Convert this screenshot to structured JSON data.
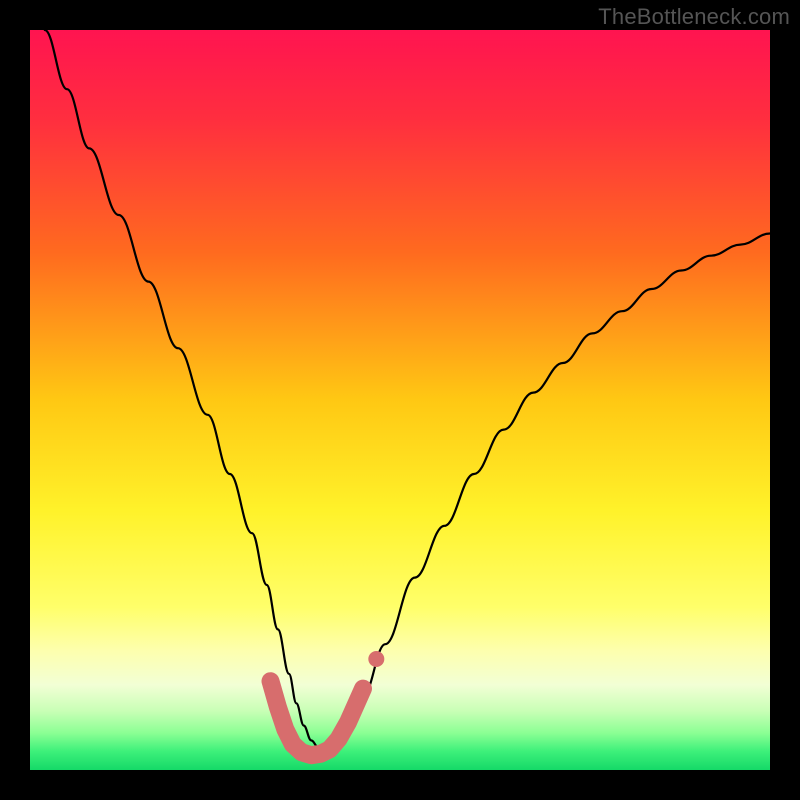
{
  "watermark": "TheBottleneck.com",
  "colors": {
    "frame": "#000000",
    "gradient_stops": [
      {
        "offset": 0.0,
        "color": "#ff1450"
      },
      {
        "offset": 0.12,
        "color": "#ff2e3f"
      },
      {
        "offset": 0.3,
        "color": "#ff6a1f"
      },
      {
        "offset": 0.5,
        "color": "#ffc813"
      },
      {
        "offset": 0.65,
        "color": "#fff22a"
      },
      {
        "offset": 0.78,
        "color": "#ffff6a"
      },
      {
        "offset": 0.84,
        "color": "#fdffaf"
      },
      {
        "offset": 0.885,
        "color": "#f2ffd5"
      },
      {
        "offset": 0.92,
        "color": "#c9ffb6"
      },
      {
        "offset": 0.95,
        "color": "#8bff94"
      },
      {
        "offset": 0.975,
        "color": "#3df07a"
      },
      {
        "offset": 1.0,
        "color": "#15d968"
      }
    ],
    "curve": "#000000",
    "marker_fill": "#d76d6d",
    "marker_stroke": "#c85f5f"
  },
  "chart_data": {
    "type": "line",
    "title": "",
    "xlabel": "",
    "ylabel": "",
    "xlim": [
      0,
      100
    ],
    "ylim": [
      0,
      100
    ],
    "series": [
      {
        "name": "bottleneck-curve",
        "x": [
          2,
          5,
          8,
          12,
          16,
          20,
          24,
          27,
          30,
          32,
          33.5,
          35,
          36,
          37,
          38,
          39,
          40,
          41.5,
          43,
          45,
          48,
          52,
          56,
          60,
          64,
          68,
          72,
          76,
          80,
          84,
          88,
          92,
          96,
          100
        ],
        "y": [
          100,
          92,
          84,
          75,
          66,
          57,
          48,
          40,
          32,
          25,
          19,
          13,
          9,
          6,
          4,
          3,
          3,
          4,
          6,
          10,
          17,
          26,
          33,
          40,
          46,
          51,
          55,
          59,
          62,
          65,
          67.5,
          69.5,
          71,
          72.5
        ]
      }
    ],
    "markers": {
      "name": "sweet-spot",
      "points": [
        {
          "x": 32.5,
          "y": 12.0
        },
        {
          "x": 33.5,
          "y": 8.5
        },
        {
          "x": 34.5,
          "y": 5.5
        },
        {
          "x": 35.5,
          "y": 3.5
        },
        {
          "x": 36.7,
          "y": 2.4
        },
        {
          "x": 38.0,
          "y": 2.0
        },
        {
          "x": 39.3,
          "y": 2.2
        },
        {
          "x": 40.5,
          "y": 2.8
        },
        {
          "x": 41.7,
          "y": 4.2
        },
        {
          "x": 43.0,
          "y": 6.5
        },
        {
          "x": 45.0,
          "y": 11.0
        }
      ],
      "outlier": {
        "x": 46.8,
        "y": 15.0
      }
    }
  }
}
